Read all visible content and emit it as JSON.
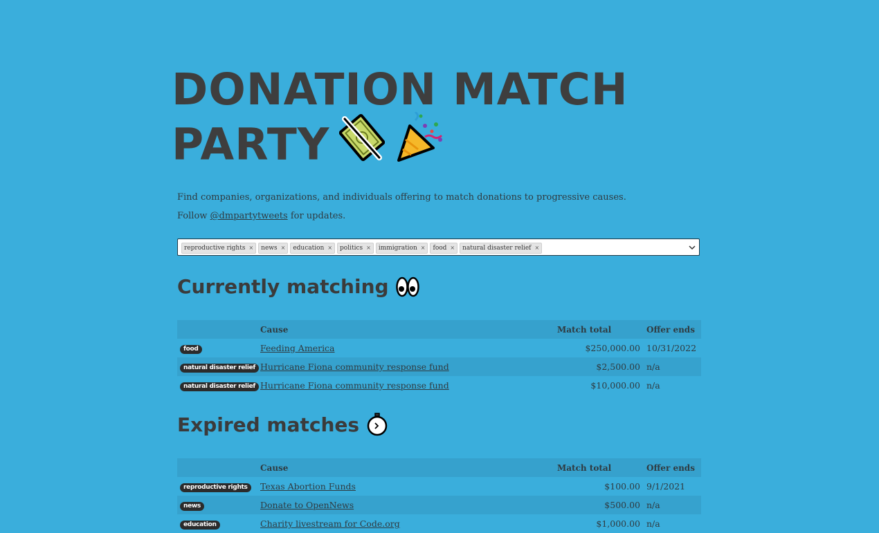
{
  "hero": {
    "line1": "DONATION MATCH",
    "line2": "PARTY",
    "emoji1": "no-money-icon",
    "emoji2": "party-popper-icon"
  },
  "intro": {
    "text1": "Find companies, organizations, and individuals offering to match donations to progressive causes.",
    "follow_prefix": "Follow ",
    "handle": "@dmpartytweets",
    "follow_suffix": " for updates."
  },
  "filter": {
    "tags": [
      {
        "label": "reproductive rights",
        "remove": "×"
      },
      {
        "label": "news",
        "remove": "×"
      },
      {
        "label": "education",
        "remove": "×"
      },
      {
        "label": "politics",
        "remove": "×"
      },
      {
        "label": "immigration",
        "remove": "×"
      },
      {
        "label": "food",
        "remove": "×"
      },
      {
        "label": "natural disaster relief",
        "remove": "×"
      }
    ]
  },
  "current": {
    "title": "Currently matching",
    "icon": "eyes-icon",
    "headers": {
      "tag": "",
      "cause": "Cause",
      "total": "Match total",
      "ends": "Offer ends"
    },
    "rows": [
      {
        "tag": "food",
        "cause": "Feeding America",
        "total": "$250,000.00",
        "ends": "10/31/2022"
      },
      {
        "tag": "natural disaster relief",
        "cause": "Hurricane Fiona community response fund",
        "total": "$2,500.00",
        "ends": "n/a"
      },
      {
        "tag": "natural disaster relief",
        "cause": "Hurricane Fiona community response fund",
        "total": "$10,000.00",
        "ends": "n/a"
      }
    ]
  },
  "expired": {
    "title": "Expired matches",
    "icon": "stopwatch-icon",
    "headers": {
      "tag": "",
      "cause": "Cause",
      "total": "Match total",
      "ends": "Offer ends"
    },
    "rows": [
      {
        "tag": "reproductive rights",
        "cause": "Texas Abortion Funds",
        "total": "$100.00",
        "ends": "9/1/2021"
      },
      {
        "tag": "news",
        "cause": "Donate to OpenNews",
        "total": "$500.00",
        "ends": "n/a"
      },
      {
        "tag": "education",
        "cause": "Charity livestream for Code.org",
        "total": "$1,000.00",
        "ends": "n/a"
      }
    ]
  },
  "colors": {
    "background": "#3aaedc",
    "header_row": "#36a1cd",
    "pill": "#2b2b2b"
  }
}
